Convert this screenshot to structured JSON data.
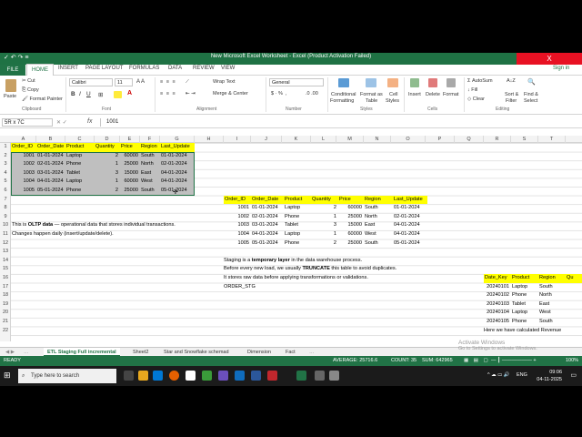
{
  "window": {
    "title": "New Microsoft Excel Worksheet - Excel (Product Activation Failed)",
    "quick_access": "✓ ↶ ↷ ≡",
    "sign_in": "Sign in",
    "close": "X"
  },
  "menu": [
    "FILE",
    "HOME",
    "INSERT",
    "PAGE LAYOUT",
    "FORMULAS",
    "DATA",
    "REVIEW",
    "VIEW"
  ],
  "ribbon": {
    "paste": "Paste",
    "cut": "Cut",
    "copy": "Copy",
    "format_painter": "Format Painter",
    "clipboard": "Clipboard",
    "font_name": "Calibri",
    "font_size": "11",
    "font": "Font",
    "wrap_text": "Wrap Text",
    "merge_center": "Merge & Center",
    "alignment": "Alignment",
    "number_format": "General",
    "currency": "$ · %  ,",
    "number": "Number",
    "conditional": "Conditional",
    "formatting": "Formatting",
    "format_as": "Format as",
    "table": "Table",
    "cell": "Cell",
    "styles_btn": "Styles",
    "styles": "Styles",
    "insert": "Insert",
    "delete": "Delete",
    "format": "Format",
    "cells": "Cells",
    "autosum": "AutoSum",
    "fill": "Fill",
    "clear": "Clear",
    "sort": "Sort &",
    "filter": "Filter",
    "find": "Find &",
    "select": "Select",
    "editing": "Editing"
  },
  "formula_bar": {
    "name_box": "5R x 7C",
    "fx": "fx",
    "value": "1001"
  },
  "columns": [
    "A",
    "B",
    "C",
    "D",
    "E",
    "F",
    "G",
    "H",
    "I",
    "J",
    "K",
    "L",
    "M",
    "N",
    "O",
    "P",
    "Q",
    "R",
    "S",
    "T"
  ],
  "rows": [
    "1",
    "2",
    "3",
    "4",
    "5",
    "6",
    "7",
    "8",
    "9",
    "10",
    "11",
    "12",
    "13",
    "14",
    "15",
    "16",
    "17",
    "18",
    "19",
    "20",
    "21",
    "22"
  ],
  "table1": {
    "headers": [
      "Order_ID",
      "Order_Date",
      "Product",
      "Quantity",
      "Price",
      "Region",
      "Last_Update"
    ],
    "rows": [
      [
        "1001",
        "01-01-2024",
        "Laptop",
        "2",
        "60000",
        "South",
        "01-01-2024"
      ],
      [
        "1002",
        "02-01-2024",
        "Phone",
        "1",
        "25000",
        "North",
        "02-01-2024"
      ],
      [
        "1003",
        "03-01-2024",
        "Tablet",
        "3",
        "15000",
        "East",
        "04-01-2024"
      ],
      [
        "1004",
        "04-01-2024",
        "Laptop",
        "1",
        "60000",
        "West",
        "04-01-2024"
      ],
      [
        "1005",
        "05-01-2024",
        "Phone",
        "2",
        "25000",
        "South",
        "05-01-2024"
      ]
    ]
  },
  "table2": {
    "headers": [
      "Order_ID",
      "Order_Date",
      "Product",
      "Quantity",
      "Price",
      "Region",
      "Last_Update"
    ],
    "rows": [
      [
        "1001",
        "01-01-2024",
        "Laptop",
        "2",
        "60000",
        "South",
        "01-01-2024"
      ],
      [
        "1002",
        "02-01-2024",
        "Phone",
        "1",
        "25000",
        "North",
        "02-01-2024"
      ],
      [
        "1003",
        "03-01-2024",
        "Tablet",
        "3",
        "15000",
        "East",
        "04-01-2024"
      ],
      [
        "1004",
        "04-01-2024",
        "Laptop",
        "1",
        "60000",
        "West",
        "04-01-2024"
      ],
      [
        "1005",
        "05-01-2024",
        "Phone",
        "2",
        "25000",
        "South",
        "05-01-2024"
      ]
    ]
  },
  "table3": {
    "headers": [
      "Date_Key",
      "Product",
      "Region",
      "Qu"
    ],
    "rows": [
      [
        "20240101",
        "Laptop",
        "South"
      ],
      [
        "20240102",
        "Phone",
        "North"
      ],
      [
        "20240103",
        "Tablet",
        "East"
      ],
      [
        "20240104",
        "Laptop",
        "West"
      ],
      [
        "20240105",
        "Phone",
        "South"
      ]
    ]
  },
  "notes": {
    "oltp_a": "This is ",
    "oltp_b": "OLTP data",
    "oltp_c": " — operational data that stores individual transactions.",
    "changes": "Changes happen daily (insert/update/delete).",
    "staging_a": "Staging is a ",
    "staging_b": "temporary layer",
    "staging_c": " in the data warehouse process.",
    "before_a": "Before every new load, we usually ",
    "before_b": "TRUNCATE",
    "before_c": " this table to avoid duplicates.",
    "stores": "It stores raw data before applying transformations or validations.",
    "order_stg": "ORDER_STG",
    "calc": "Here we have calculated Revenue"
  },
  "sheets": [
    "ETL Staging Full incremental",
    "Sheet2",
    "Star and Snowflake schemad",
    "Dimension",
    "Fact"
  ],
  "status": {
    "ready": "READY",
    "average": "AVERAGE: 25716.6",
    "count": "COUNT: 35",
    "sum": "SUM: 642965",
    "zoom": "100%"
  },
  "activation": {
    "line1": "Activate Windows",
    "line2": "Go to Settings to activate Windows."
  },
  "taskbar": {
    "search": "Type here to search",
    "lang": "ENG",
    "time": "09:06",
    "date": "04-11-2025"
  },
  "colors": {
    "excel_green": "#217346",
    "header_yellow": "#ffff00",
    "selection_gray": "#bfbfbf",
    "alert_red": "#e81123"
  }
}
